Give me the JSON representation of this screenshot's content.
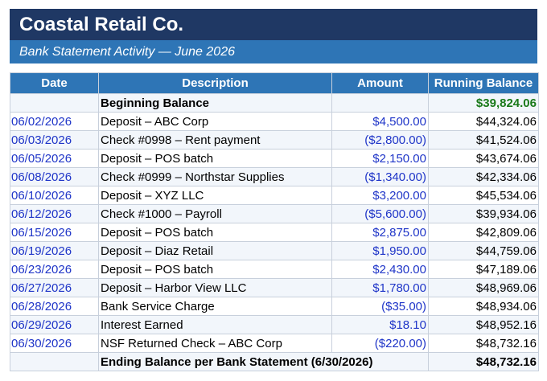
{
  "header": {
    "company": "Coastal Retail Co.",
    "subtitle": "Bank Statement Activity — June 2026"
  },
  "columns": [
    "Date",
    "Description",
    "Amount",
    "Running Balance"
  ],
  "beginning": {
    "label": "Beginning Balance",
    "balance": "$39,824.06"
  },
  "rows": [
    {
      "date": "06/02/2026",
      "description": "Deposit – ABC Corp",
      "amount": "$4,500.00",
      "balance": "$44,324.06"
    },
    {
      "date": "06/03/2026",
      "description": "Check #0998 – Rent payment",
      "amount": "($2,800.00)",
      "balance": "$41,524.06"
    },
    {
      "date": "06/05/2026",
      "description": "Deposit – POS batch",
      "amount": "$2,150.00",
      "balance": "$43,674.06"
    },
    {
      "date": "06/08/2026",
      "description": "Check #0999 – Northstar Supplies",
      "amount": "($1,340.00)",
      "balance": "$42,334.06"
    },
    {
      "date": "06/10/2026",
      "description": "Deposit – XYZ LLC",
      "amount": "$3,200.00",
      "balance": "$45,534.06"
    },
    {
      "date": "06/12/2026",
      "description": "Check #1000 – Payroll",
      "amount": "($5,600.00)",
      "balance": "$39,934.06"
    },
    {
      "date": "06/15/2026",
      "description": "Deposit – POS batch",
      "amount": "$2,875.00",
      "balance": "$42,809.06"
    },
    {
      "date": "06/19/2026",
      "description": "Deposit – Diaz Retail",
      "amount": "$1,950.00",
      "balance": "$44,759.06"
    },
    {
      "date": "06/23/2026",
      "description": "Deposit – POS batch",
      "amount": "$2,430.00",
      "balance": "$47,189.06"
    },
    {
      "date": "06/27/2026",
      "description": "Deposit – Harbor View LLC",
      "amount": "$1,780.00",
      "balance": "$48,969.06"
    },
    {
      "date": "06/28/2026",
      "description": "Bank Service Charge",
      "amount": "($35.00)",
      "balance": "$48,934.06"
    },
    {
      "date": "06/29/2026",
      "description": "Interest Earned",
      "amount": "$18.10",
      "balance": "$48,952.16"
    },
    {
      "date": "06/30/2026",
      "description": "NSF Returned Check – ABC Corp",
      "amount": "($220.00)",
      "balance": "$48,732.16"
    }
  ],
  "ending": {
    "label": "Ending Balance per Bank Statement (6/30/2026)",
    "balance": "$48,732.16"
  },
  "colors": {
    "banner": "#1f3864",
    "subbar": "#2e75b6",
    "link_blue": "#1f35c8",
    "begin_green": "#1a7a1a"
  }
}
